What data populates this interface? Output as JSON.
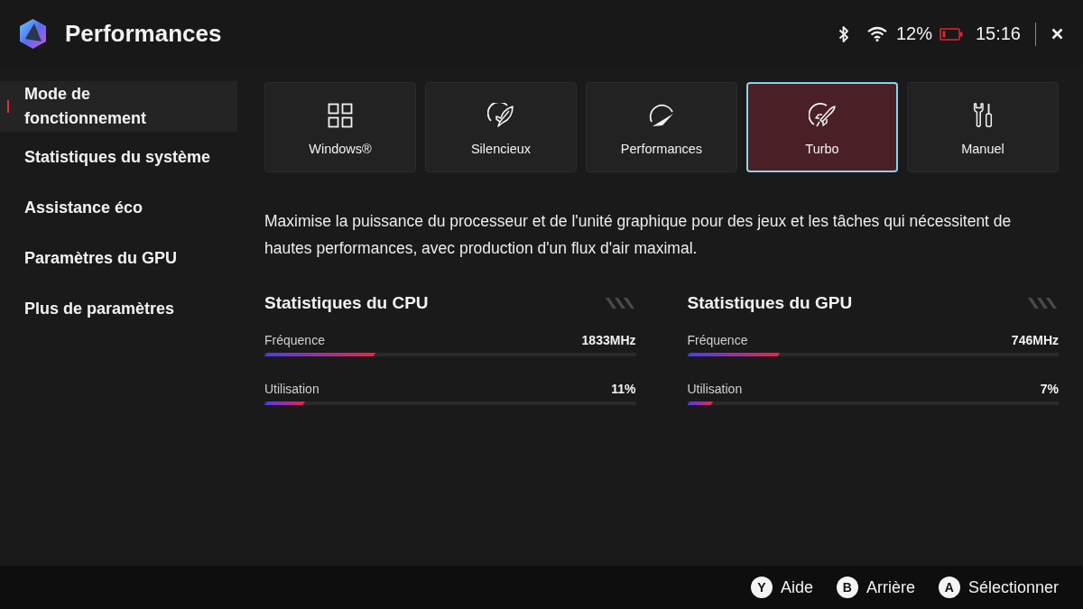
{
  "header": {
    "title": "Performances",
    "battery": "12%",
    "time": "15:16"
  },
  "sidebar": {
    "items": [
      {
        "label": "Mode de fonctionnement",
        "selected": true
      },
      {
        "label": "Statistiques du système",
        "selected": false
      },
      {
        "label": "Assistance éco",
        "selected": false
      },
      {
        "label": "Paramètres du GPU",
        "selected": false
      },
      {
        "label": "Plus de paramètres",
        "selected": false
      }
    ]
  },
  "modes": [
    {
      "kind": "windows",
      "label": "Windows®",
      "selected": false
    },
    {
      "kind": "silent",
      "label": "Silencieux",
      "selected": false
    },
    {
      "kind": "performance",
      "label": "Performances",
      "selected": false
    },
    {
      "kind": "turbo",
      "label": "Turbo",
      "selected": true
    },
    {
      "kind": "manual",
      "label": "Manuel",
      "selected": false
    }
  ],
  "description": "Maximise la puissance du processeur et de l'unité graphique pour des jeux et les tâches qui nécessitent de hautes performances, avec production d'un flux d'air maximal.",
  "stats": [
    {
      "title": "Statistiques du CPU",
      "rows": [
        {
          "label": "Fréquence",
          "value": "1833MHz",
          "level": 0.3
        },
        {
          "label": "Utilisation",
          "value": "11%",
          "level": 0.11
        }
      ]
    },
    {
      "title": "Statistiques du GPU",
      "rows": [
        {
          "label": "Fréquence",
          "value": "746MHz",
          "level": 0.25
        },
        {
          "label": "Utilisation",
          "value": "7%",
          "level": 0.07
        }
      ]
    }
  ],
  "footer": {
    "actions": [
      {
        "key": "Y",
        "label": "Aide"
      },
      {
        "key": "B",
        "label": "Arrière"
      },
      {
        "key": "A",
        "label": "Sélectionner"
      }
    ]
  }
}
